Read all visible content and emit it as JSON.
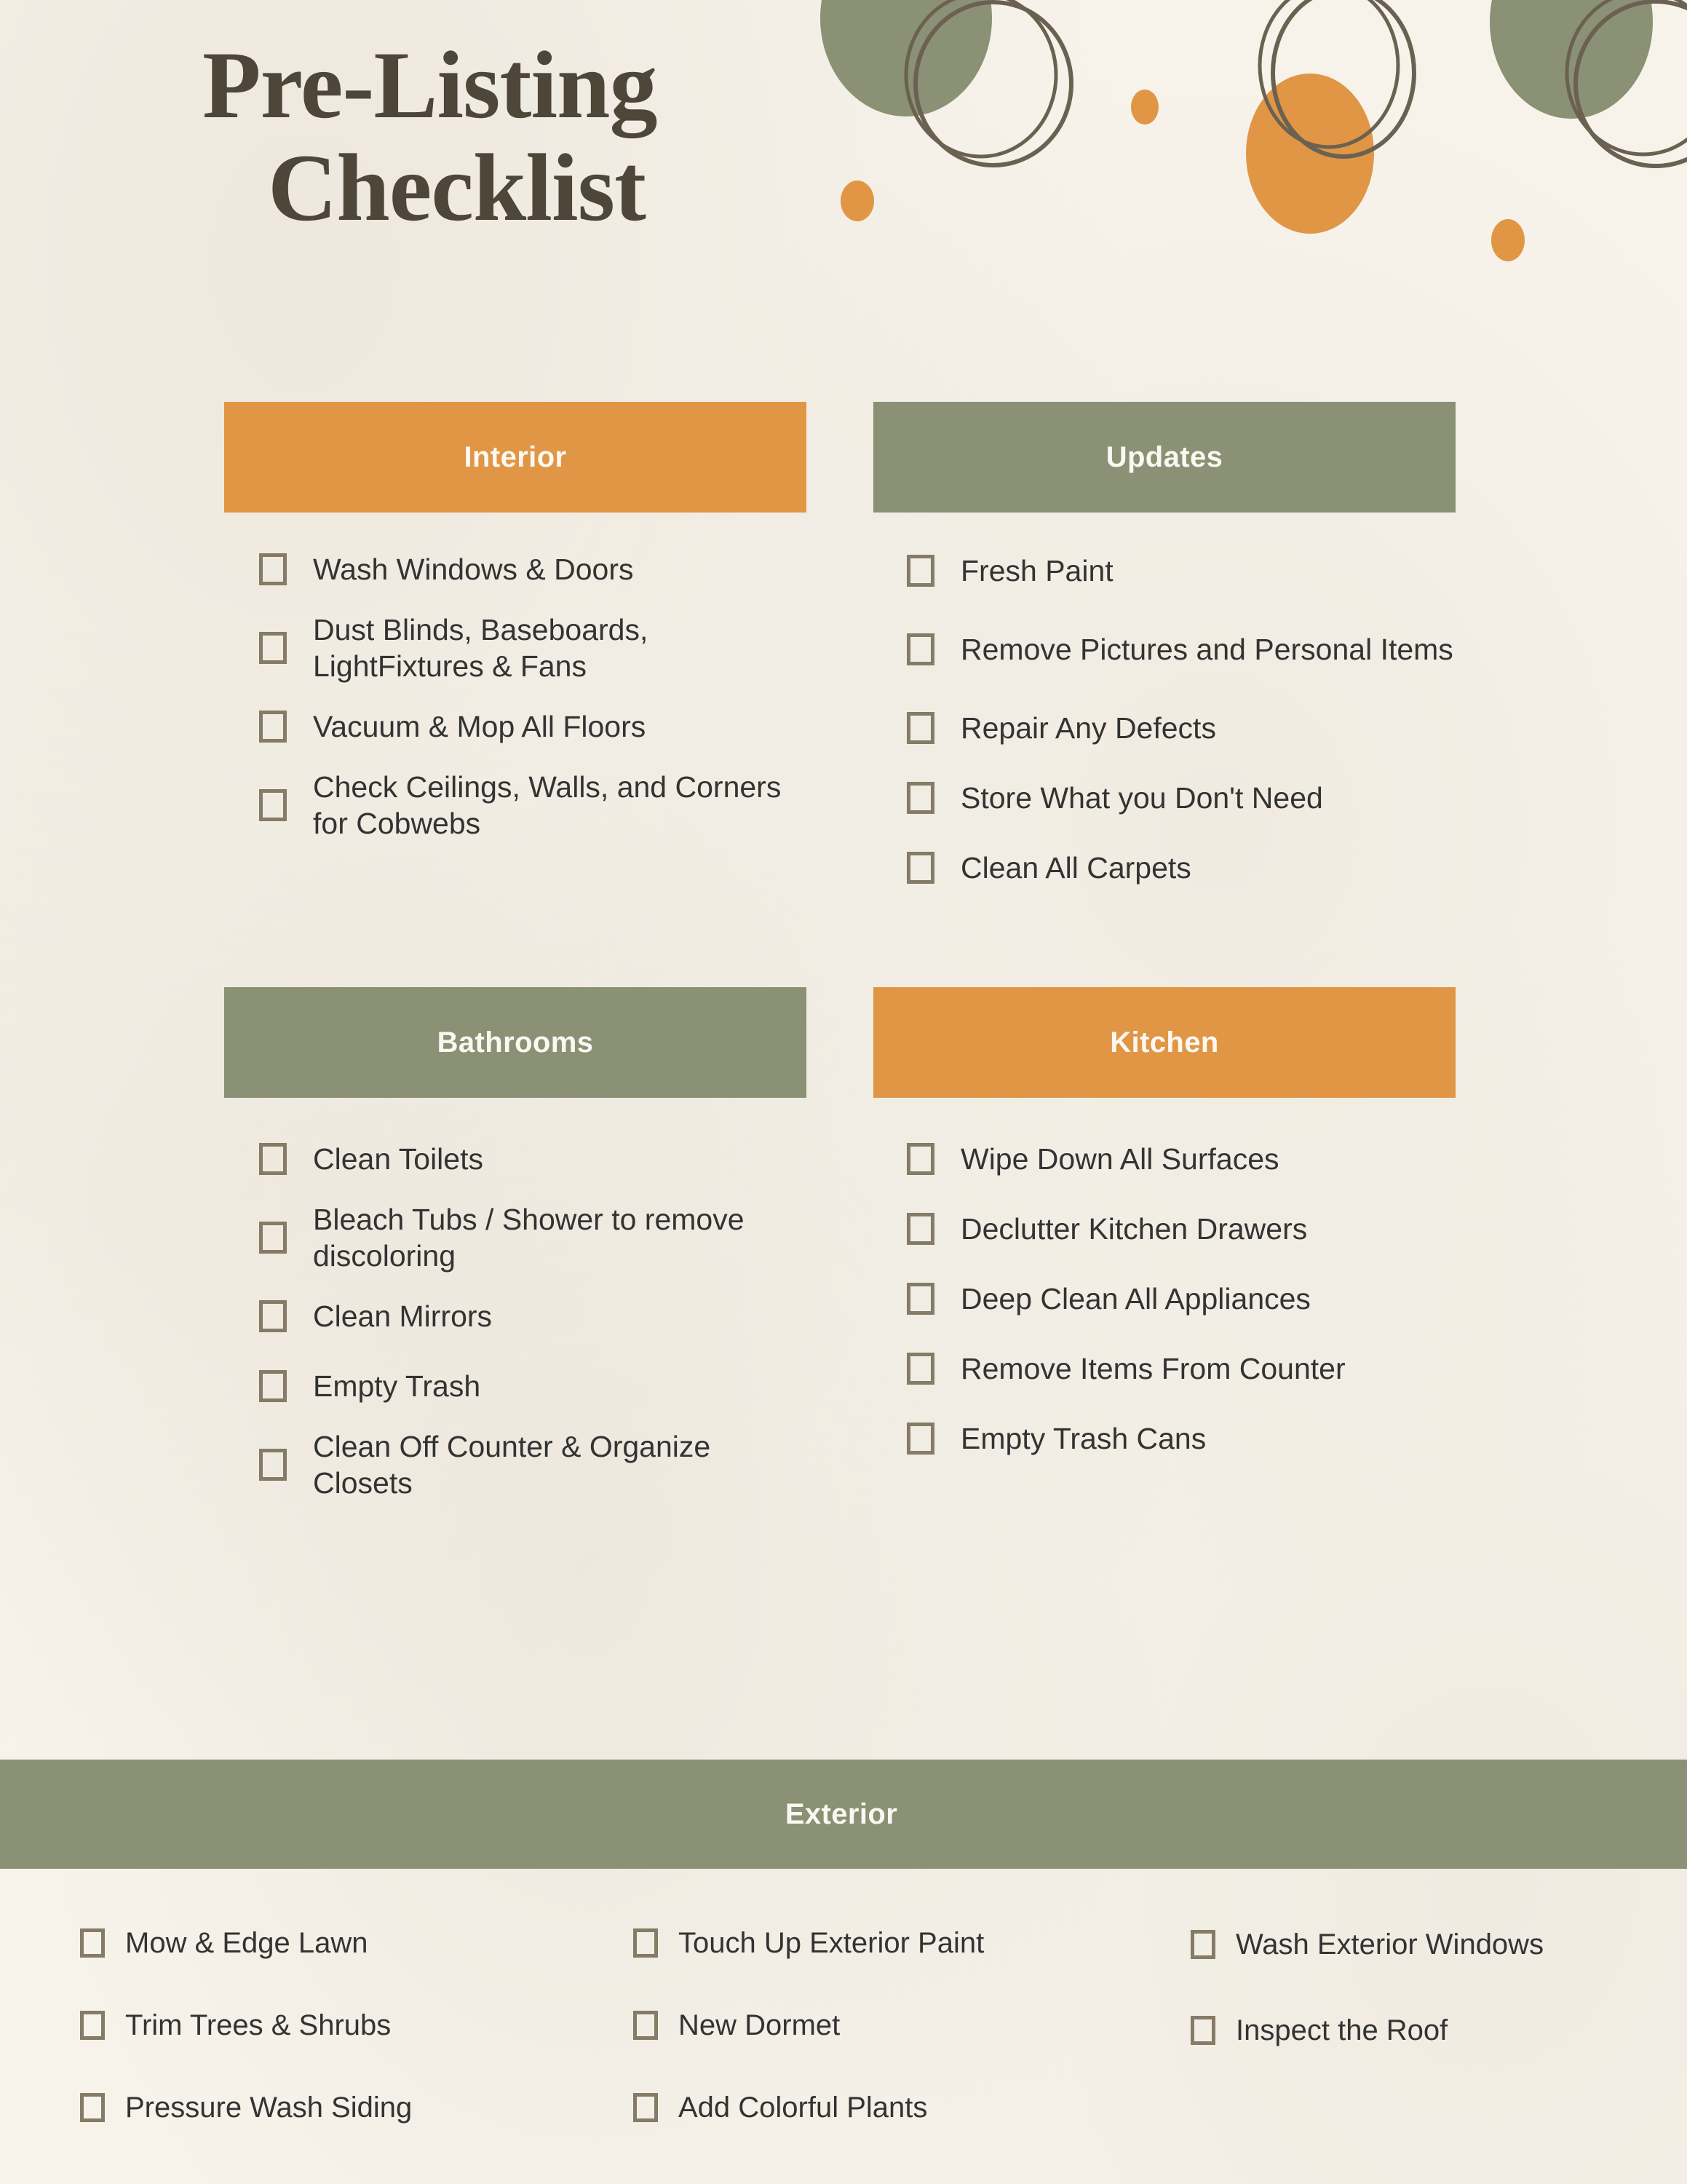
{
  "title": {
    "line1": "Pre-Listing",
    "line2": "Checklist"
  },
  "colors": {
    "orange": "#e09645",
    "green": "#8b9174",
    "background": "#f7f3eb",
    "title_text": "#4d4639",
    "checkbox_border": "#857b66",
    "item_text": "#333333",
    "header_text": "#fbf8f2",
    "ring_outline": "#6a6151"
  },
  "sections": {
    "interior": {
      "header": "Interior",
      "accent": "orange",
      "items": [
        "Wash Windows & Doors",
        "Dust Blinds, Baseboards, LightFixtures & Fans",
        "Vacuum & Mop All Floors",
        "Check Ceilings, Walls, and Corners for Cobwebs"
      ]
    },
    "updates": {
      "header": "Updates",
      "accent": "green",
      "items": [
        "Fresh Paint",
        "Remove Pictures and Personal Items",
        "Repair Any Defects",
        "Store What you Don't Need",
        "Clean All Carpets"
      ]
    },
    "bathrooms": {
      "header": "Bathrooms",
      "accent": "green",
      "items": [
        "Clean Toilets",
        "Bleach Tubs / Shower to remove discoloring",
        "Clean Mirrors",
        "Empty Trash",
        "Clean Off Counter & Organize Closets"
      ]
    },
    "kitchen": {
      "header": "Kitchen",
      "accent": "orange",
      "items": [
        "Wipe Down All Surfaces",
        "Declutter Kitchen Drawers",
        "Deep Clean All Appliances",
        "Remove Items From Counter",
        "Empty Trash Cans"
      ]
    },
    "exterior": {
      "header": "Exterior",
      "accent": "green",
      "column1": [
        "Mow & Edge Lawn",
        "Trim Trees & Shrubs",
        "Pressure Wash Siding"
      ],
      "column2": [
        "Touch Up Exterior Paint",
        "New Dormet",
        "Add Colorful Plants"
      ],
      "column3": [
        "Wash Exterior Windows",
        "Inspect the Roof"
      ]
    }
  },
  "decorations": {
    "items": [
      "green-blob-left",
      "ring-outline-left-outer",
      "ring-outline-left-inner",
      "orange-dot-small-left",
      "orange-dot-small-left-lower",
      "orange-blob-center",
      "ring-outline-center-outer",
      "ring-outline-center-inner",
      "green-blob-right",
      "ring-outline-right-outer",
      "ring-outline-right-inner",
      "orange-dot-small-right"
    ]
  }
}
